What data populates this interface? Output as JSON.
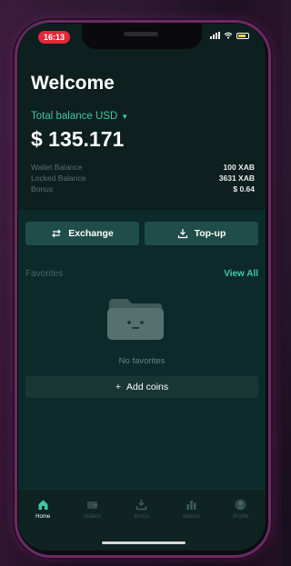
{
  "status": {
    "time": "16:13"
  },
  "header": {
    "welcome": "Welcome",
    "total_label": "Total balance USD",
    "total_value": "$ 135.171"
  },
  "balances": [
    {
      "label": "Wallet Balance",
      "value": "100 XAB"
    },
    {
      "label": "Locked Balance",
      "value": "3631 XAB"
    },
    {
      "label": "Bonus",
      "value": "$ 0.64"
    }
  ],
  "actions": {
    "exchange_label": "Exchange",
    "topup_label": "Top-up"
  },
  "favorites": {
    "title": "Favorites",
    "view_all": "View All",
    "empty_text": "No favorites",
    "add_label": "Add coins"
  },
  "tabs": [
    {
      "label": "Home",
      "icon": "home-icon",
      "active": true
    },
    {
      "label": "Wallets",
      "icon": "wallet-icon",
      "active": false
    },
    {
      "label": "Bonus",
      "icon": "bonus-icon",
      "active": false
    },
    {
      "label": "Market",
      "icon": "market-icon",
      "active": false
    },
    {
      "label": "Profile",
      "icon": "profile-icon",
      "active": false
    }
  ],
  "colors": {
    "accent": "#3fc9a7",
    "button": "#1f4d49",
    "background": "#0c2a2a"
  }
}
